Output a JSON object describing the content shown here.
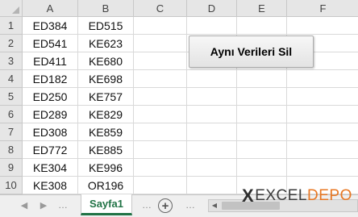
{
  "columns": [
    "A",
    "B",
    "C",
    "D",
    "E",
    "F"
  ],
  "rows": [
    {
      "num": "1",
      "a": "ED384",
      "b": "ED515"
    },
    {
      "num": "2",
      "a": "ED541",
      "b": "KE623"
    },
    {
      "num": "3",
      "a": "ED411",
      "b": "KE680"
    },
    {
      "num": "4",
      "a": "ED182",
      "b": "KE698"
    },
    {
      "num": "5",
      "a": "ED250",
      "b": "KE757"
    },
    {
      "num": "6",
      "a": "ED289",
      "b": "KE829"
    },
    {
      "num": "7",
      "a": "ED308",
      "b": "KE859"
    },
    {
      "num": "8",
      "a": "ED772",
      "b": "KE885"
    },
    {
      "num": "9",
      "a": "KE304",
      "b": "KE996"
    },
    {
      "num": "10",
      "a": "KE308",
      "b": "OR196"
    }
  ],
  "button": {
    "label": "Aynı Verileri Sil"
  },
  "tabs": {
    "active_sheet": "Sayfa1",
    "dots": "…",
    "add_symbol": "+",
    "prev_icon": "triangle-left-icon",
    "next_icon": "triangle-right-icon"
  },
  "watermark": {
    "x": "X",
    "part1": "EXCEL",
    "part2": "DEPO"
  },
  "colors": {
    "accent_green": "#217346",
    "logo_orange": "#e87722"
  }
}
